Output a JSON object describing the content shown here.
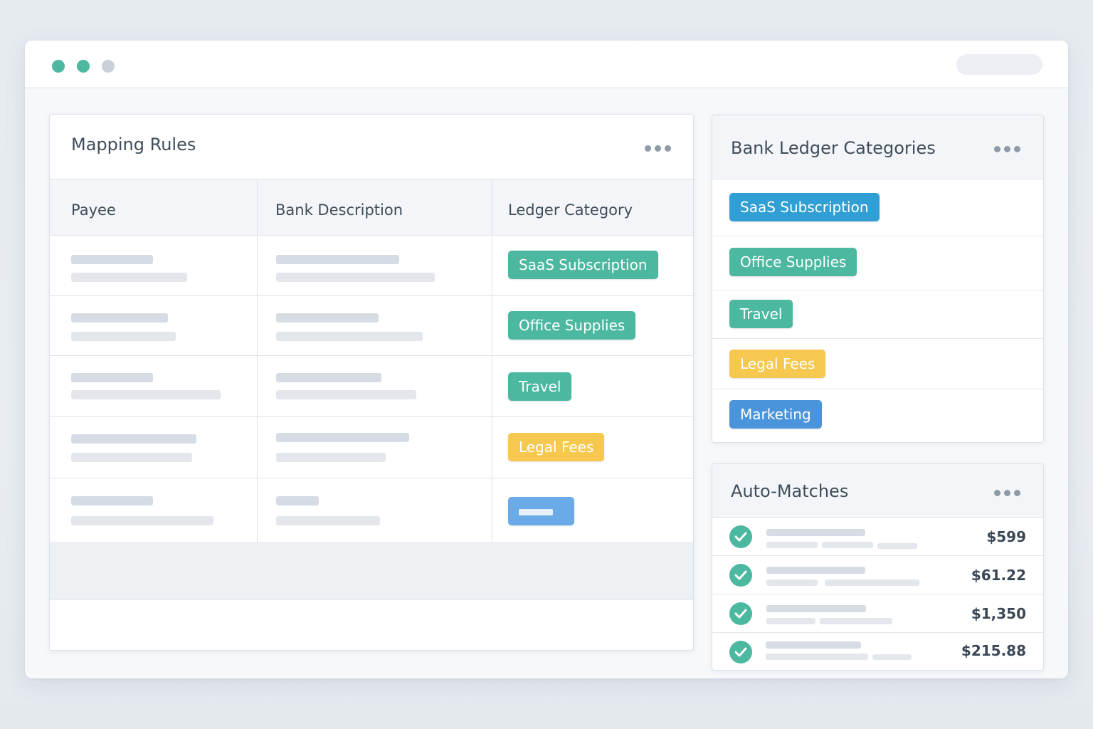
{
  "window": {
    "controls": [
      "dot-1",
      "dot-2",
      "dot-3"
    ]
  },
  "mapping": {
    "title": "Mapping Rules",
    "more_icon": "ellipsis-icon",
    "columns": [
      "Payee",
      "Bank Description",
      "Ledger Category"
    ],
    "rows": [
      {
        "category": "SaaS Subscription",
        "color": "#4cb8a0"
      },
      {
        "category": "Office Supplies",
        "color": "#4cb8a0"
      },
      {
        "category": "Travel",
        "color": "#4cb8a0"
      },
      {
        "category": "Legal Fees",
        "color": "#f6c84f"
      },
      {
        "category": "",
        "color": "#6aaae6"
      }
    ]
  },
  "ledger": {
    "title": "Bank Ledger Categories",
    "more_icon": "ellipsis-icon",
    "items": [
      {
        "label": "SaaS Subscription",
        "color": "#2f9fd6"
      },
      {
        "label": "Office Supplies",
        "color": "#4cb8a0"
      },
      {
        "label": "Travel",
        "color": "#4cb8a0"
      },
      {
        "label": "Legal Fees",
        "color": "#f6c84f"
      },
      {
        "label": "Marketing",
        "color": "#4a94dc"
      }
    ]
  },
  "auto": {
    "title": "Auto-Matches",
    "more_icon": "ellipsis-icon",
    "status_icon": "check-circle-icon",
    "items": [
      {
        "amount": "$599"
      },
      {
        "amount": "$61.22"
      },
      {
        "amount": "$1,350"
      },
      {
        "amount": "$215.88"
      }
    ]
  }
}
